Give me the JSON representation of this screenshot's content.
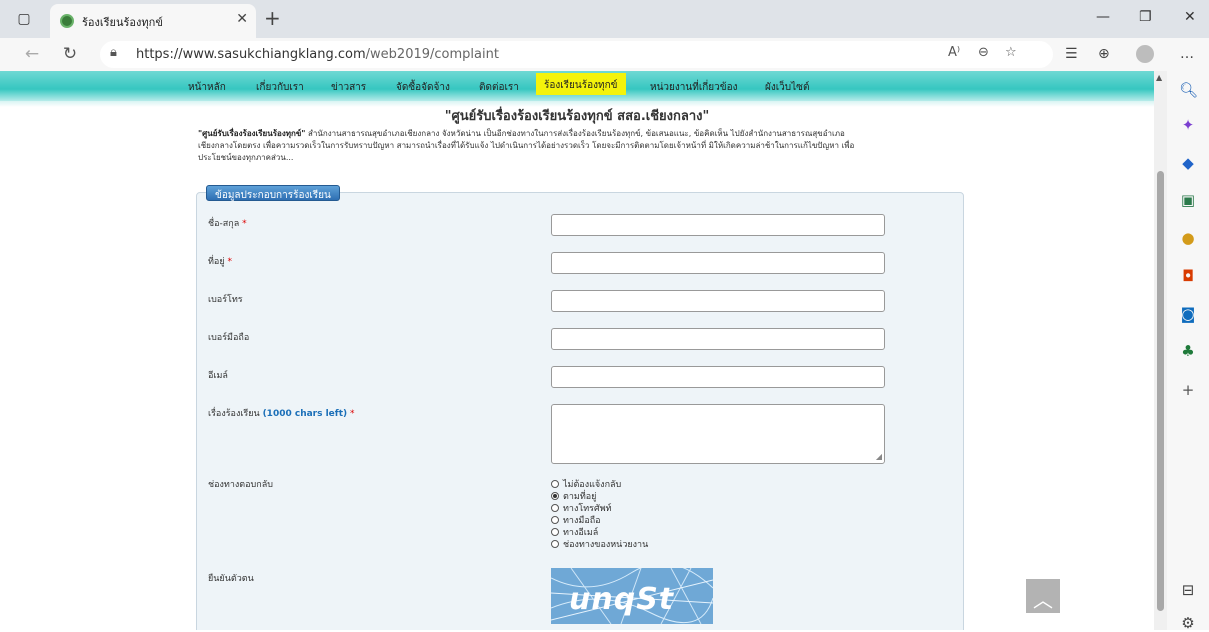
{
  "browser": {
    "tab_title": "ร้องเรียนร้องทุกข์",
    "url_host": "https://www.sasukchiangklang.com",
    "url_path": "/web2019/complaint"
  },
  "site_nav": {
    "items": [
      "หน้าหลัก",
      "เกี่ยวกับเรา",
      "ข่าวสาร",
      "จัดซื้อจัดจ้าง",
      "ติดต่อเรา",
      "ร้องเรียนร้องทุกข์",
      "หน่วยงานที่เกี่ยวข้อง",
      "ผังเว็บไซต์"
    ],
    "active_index": 5
  },
  "page": {
    "heading": "\"ศูนย์รับเรื่องร้องเรียนร้องทุกข์ สสอ.เชียงกลาง\"",
    "intro_bold": "\"ศูนย์รับเรื่องร้องเรียนร้องทุกข์\"",
    "intro_line1_rest": " สำนักงานสาธารณสุขอำเภอเชียงกลาง จังหวัดน่าน เป็นอีกช่องทางในการส่งเรื่องร้องเรียนร้องทุกข์, ข้อเสนอแนะ, ข้อคิดเห็น ไปยังสำนักงานสาธารณสุขอำเภอ",
    "intro_line2": "เชียงกลางโดยตรง เพื่อความรวดเร็วในการรับทราบปัญหา สามารถนำเรื่องที่ได้รับแจ้ง ไปดำเนินการได้อย่างรวดเร็ว โดยจะมีการติดตามโดยเจ้าหน้าที่ มิให้เกิดความล่าช้าในการแก้ไขปัญหา เพื่อ",
    "intro_line3": "ประโยชน์ของทุกภาคส่วน..."
  },
  "form": {
    "legend": "ข้อมูลประกอบการร้องเรียน",
    "name_label": "ชื่อ-สกุล",
    "address_label": "ที่อยู่",
    "phone_label": "เบอร์โทร",
    "mobile_label": "เบอร์มือถือ",
    "email_label": "อีเมล์",
    "subject_label": "เรื่องร้องเรียน",
    "chars_left": "(1000 chars left)",
    "required_mark": "*",
    "reply_label": "ช่องทางตอบกลับ",
    "reply_options": [
      "ไม่ต้องแจ้งกลับ",
      "ตามที่อยู่",
      "ทางโทรศัพท์",
      "ทางมือถือ",
      "ทางอีเมล์",
      "ช่องทางของหน่วยงาน"
    ],
    "reply_selected": 1,
    "verify_label": "ยืนยันตัวตน",
    "captcha_text": "unqSt"
  }
}
